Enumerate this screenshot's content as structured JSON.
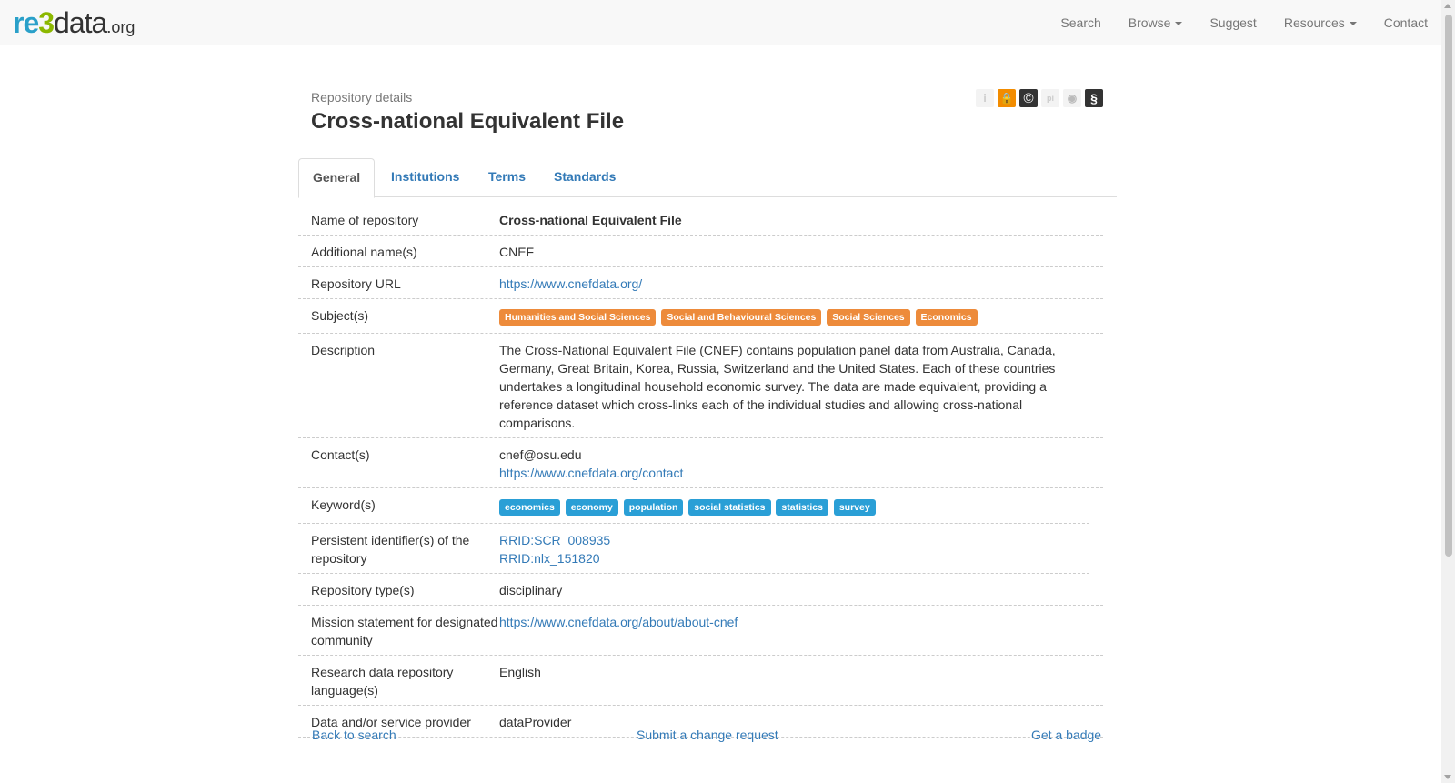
{
  "nav": {
    "logo": {
      "re": "re",
      "three": "3",
      "data": "data",
      "org": ".org"
    },
    "items": [
      "Search",
      "Browse",
      "Suggest",
      "Resources",
      "Contact"
    ]
  },
  "header": {
    "subtitle": "Repository details",
    "title": "Cross-national Equivalent File",
    "badges": {
      "info": "i",
      "lock": "🔒",
      "copyright": "©",
      "pid": "pi",
      "cert": "◉",
      "policy": "§"
    }
  },
  "tabs": [
    "General",
    "Institutions",
    "Terms",
    "Standards"
  ],
  "details": {
    "name_label": "Name of repository",
    "name_value": "Cross-national Equivalent File",
    "additional_label": "Additional name(s)",
    "additional_value": "CNEF",
    "url_label": "Repository URL",
    "url_value": "https://www.cnefdata.org/",
    "subjects_label": "Subject(s)",
    "subjects": [
      "Humanities and Social Sciences",
      "Social and Behavioural Sciences",
      "Social Sciences",
      "Economics"
    ],
    "description_label": "Description",
    "description_value": "The Cross-National Equivalent File (CNEF) contains population panel data from Australia, Canada, Germany, Great Britain, Korea, Russia, Switzerland and the United States. Each of these countries undertakes a longitudinal household economic survey. The data are made equivalent, providing a reference dataset which cross-links each of the individual studies and allowing cross-national comparisons.",
    "contacts_label": "Contact(s)",
    "contact_email": "cnef@osu.edu",
    "contact_url": "https://www.cnefdata.org/contact",
    "keywords_label": "Keyword(s)",
    "keywords": [
      "economics",
      "economy",
      "population",
      "social statistics",
      "statistics",
      "survey"
    ],
    "pid_label": "Persistent identifier(s) of the repository",
    "pids": [
      "RRID:SCR_008935",
      "RRID:nlx_151820"
    ],
    "type_label": "Repository type(s)",
    "type_value": "disciplinary",
    "mission_label": "Mission statement for designated community",
    "mission_value": "https://www.cnefdata.org/about/about-cnef",
    "language_label": "Research data repository language(s)",
    "language_value": "English",
    "provider_label": "Data and/or service provider",
    "provider_value": "dataProvider"
  },
  "footer": {
    "back": "Back to search",
    "change": "Submit a change request",
    "badge": "Get a badge"
  },
  "colors": {
    "subject_tag": "#ed8b3b",
    "keyword_tag": "#2a9fd6",
    "link": "#337ab7"
  }
}
